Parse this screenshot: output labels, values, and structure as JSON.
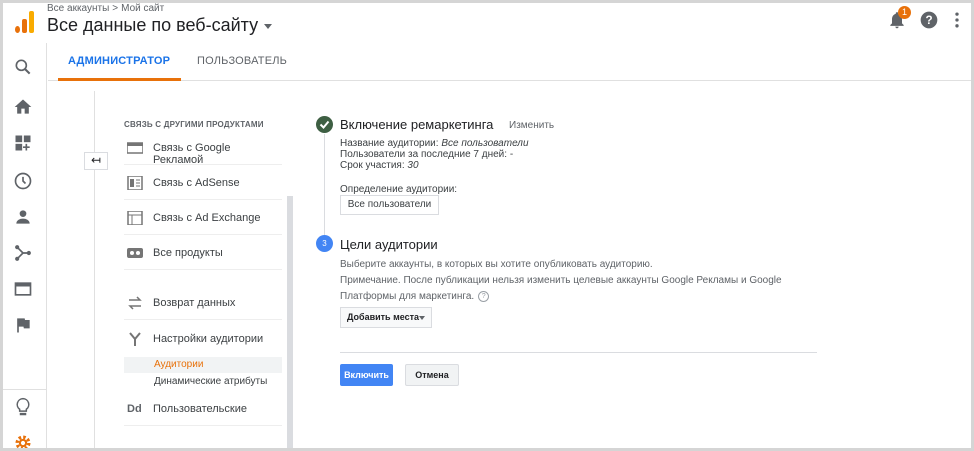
{
  "header": {
    "breadcrumb": [
      "Все аккаунты",
      "Мой сайт"
    ],
    "breadcrumb_separator": ">",
    "account_title": "Все данные по веб-сайту",
    "notification_count": "1",
    "icons": [
      "analytics-logo-icon",
      "bell-icon",
      "help-icon",
      "kebab-menu-icon"
    ]
  },
  "rail": {
    "icons": [
      "search-icon",
      "home-icon",
      "dashboard-icon",
      "clock-icon",
      "person-icon",
      "fork-icon",
      "window-icon",
      "flag-icon",
      "lightbulb-icon",
      "settings-gear-icon"
    ]
  },
  "tabs": {
    "admin": "АДМИНИСТРАТОР",
    "user": "ПОЛЬЗОВАТЕЛЬ"
  },
  "nav": {
    "section_title": "СВЯЗЬ С ДРУГИМИ ПРОДУКТАМИ",
    "items": [
      {
        "label": "Связь с Google Рекламой",
        "icon": "ads-icon"
      },
      {
        "label": "Связь с AdSense",
        "icon": "adsense-icon"
      },
      {
        "label": "Связь с Ad Exchange",
        "icon": "ad-exchange-icon"
      },
      {
        "label": "Все продукты",
        "icon": "link-icon"
      },
      {
        "label": "Возврат данных",
        "icon": "swap-arrows-icon"
      },
      {
        "label": "Настройки аудитории",
        "icon": "audience-fork-icon"
      },
      {
        "label": "Пользовательские",
        "icon": "dd-icon"
      }
    ],
    "subitems": {
      "audiences": "Аудитории",
      "dynamic_attributes": "Динамические атрибуты"
    },
    "dd_glyph": "Dd",
    "back_arrow": "↤"
  },
  "step1": {
    "title": "Включение ремаркетинга",
    "change_link": "Изменить",
    "audience_name_label": "Название аудитории: ",
    "audience_name_value": "Все пользователи",
    "users_last_label": "Пользователи за последние 7 дней: ",
    "users_last_value": "-",
    "duration_label": "Срок участия: ",
    "duration_value": "30",
    "definition_label": "Определение аудитории:",
    "definition_value": "Все пользователи",
    "status_icon": "check-icon"
  },
  "step2": {
    "number": "3",
    "title": "Цели аудитории",
    "desc1": "Выберите аккаунты, в которых вы хотите опубликовать аудиторию.",
    "desc2": "Примечание. После публикации нельзя изменить целевые аккаунты Google Рекламы и Google",
    "desc3": "Платформы для маркетинга.",
    "help_glyph": "?",
    "add_places": "Добавить места"
  },
  "actions": {
    "enable": "Включить",
    "cancel": "Отмена"
  },
  "colors": {
    "accent_blue": "#1a73e8",
    "accent_orange": "#e8710a",
    "step_done": "#3e5f43",
    "step_active": "#4285f4"
  }
}
